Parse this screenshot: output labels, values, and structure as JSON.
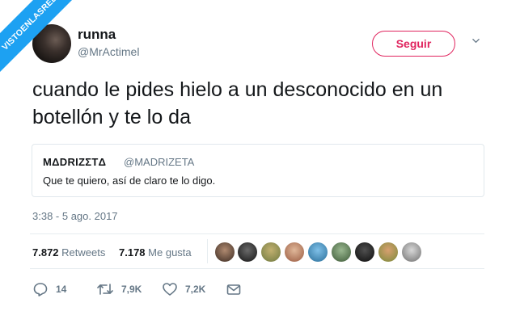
{
  "watermark": {
    "text": "VISTOENLASREDES"
  },
  "user": {
    "display_name": "runna",
    "handle": "@MrActimel"
  },
  "follow_button": {
    "label": "Seguir",
    "color": "#e0245e"
  },
  "tweet": {
    "text": "cuando le pides hielo a un desconocido en un botellón y te lo da",
    "timestamp": "3:38 - 5 ago. 2017"
  },
  "quoted_tweet": {
    "display_name": "MΔDRIZΣTΔ",
    "handle": "@MADRIZETA",
    "text": "Que te quiero, así de claro te lo digo."
  },
  "stats": {
    "retweets_count": "7.872",
    "retweets_label": "Retweets",
    "likes_count": "7.178",
    "likes_label": "Me gusta"
  },
  "actions": {
    "reply_count": "14",
    "retweet_count": "7,9K",
    "like_count": "7,2K"
  },
  "icons": [
    "chevron-down-icon",
    "reply-icon",
    "retweet-icon",
    "heart-icon",
    "envelope-icon"
  ],
  "colors": {
    "accent": "#1da1f2",
    "secondary_text": "#657786",
    "follow": "#e0245e"
  }
}
